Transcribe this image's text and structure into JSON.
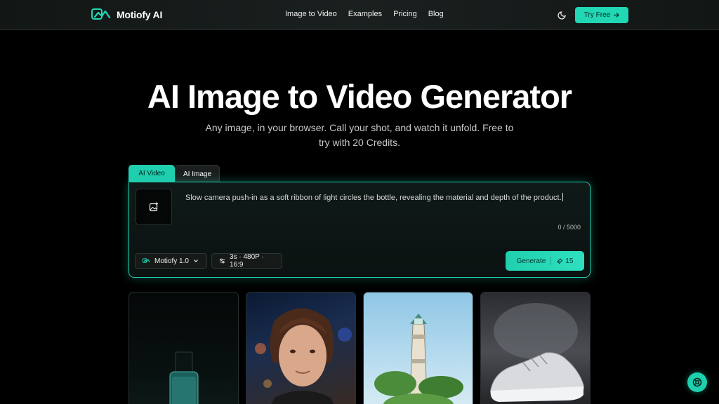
{
  "nav": {
    "brand": "Motiofy AI",
    "links": [
      "Image to Video",
      "Examples",
      "Pricing",
      "Blog"
    ],
    "cta": "Try Free"
  },
  "hero": {
    "title": "AI Image to Video Generator",
    "subtitle": "Any image, in your browser. Call your shot, and watch it unfold. Free to try with 20 Credits."
  },
  "tabs": [
    "AI Video",
    "AI Image"
  ],
  "prompt": {
    "text": "Slow camera push-in as a soft ribbon of light circles the bottle, revealing the material and depth of the product.",
    "counter": "0 / 5000",
    "model": "Motiofy 1.0",
    "settings": "3s · 480P · 16:9",
    "generate_label": "Generate",
    "generate_cost": "15"
  },
  "colors": {
    "accent": "#1fcfae",
    "background": "#000000"
  },
  "icons": [
    "motiofy-logo-icon",
    "moon-icon",
    "arrow-right-icon",
    "image-upload-icon",
    "chevron-down-icon",
    "sliders-icon",
    "credits-icon",
    "support-icon"
  ]
}
